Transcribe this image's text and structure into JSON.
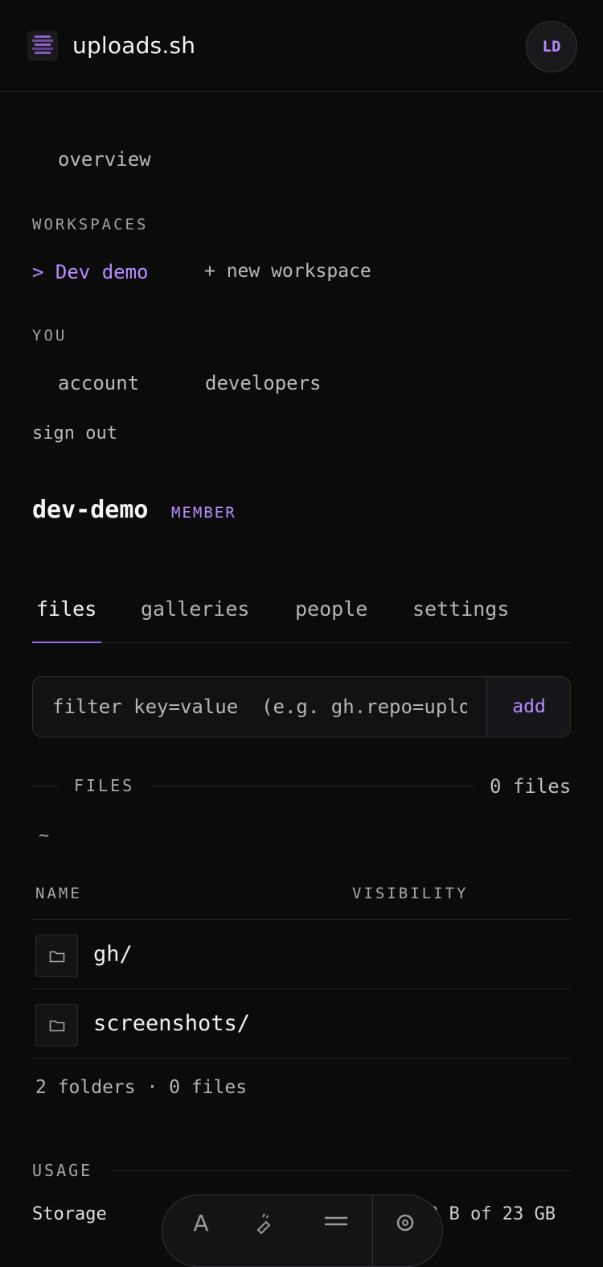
{
  "header": {
    "brand": "uploads.sh",
    "avatar_initials": "LD"
  },
  "nav": {
    "overview": "overview",
    "workspaces_label": "WORKSPACES",
    "current_workspace": "> Dev demo",
    "new_workspace": "+ new workspace",
    "you_label": "YOU",
    "account": "account",
    "developers": "developers",
    "sign_out": "sign out"
  },
  "workspace": {
    "title": "dev-demo",
    "role_badge": "MEMBER"
  },
  "tabs": [
    {
      "label": "files",
      "active": true
    },
    {
      "label": "galleries",
      "active": false
    },
    {
      "label": "people",
      "active": false
    },
    {
      "label": "settings",
      "active": false
    }
  ],
  "filter": {
    "placeholder": "filter key=value  (e.g. gh.repo=uploads)",
    "add_label": "add"
  },
  "files": {
    "section_label": "FILES",
    "count_label": "0 files",
    "breadcrumb": "~",
    "columns": {
      "name": "NAME",
      "visibility": "VISIBILITY"
    },
    "rows": [
      {
        "name": "gh/",
        "icon": "folder-icon"
      },
      {
        "name": "screenshots/",
        "icon": "folder-icon"
      }
    ],
    "summary": "2 folders · 0 files"
  },
  "usage": {
    "section_label": "USAGE",
    "storage_label": "Storage",
    "storage_value": "0 B of 23 GB"
  },
  "colors": {
    "accent": "#b78dff",
    "background": "#0b0b0c"
  }
}
